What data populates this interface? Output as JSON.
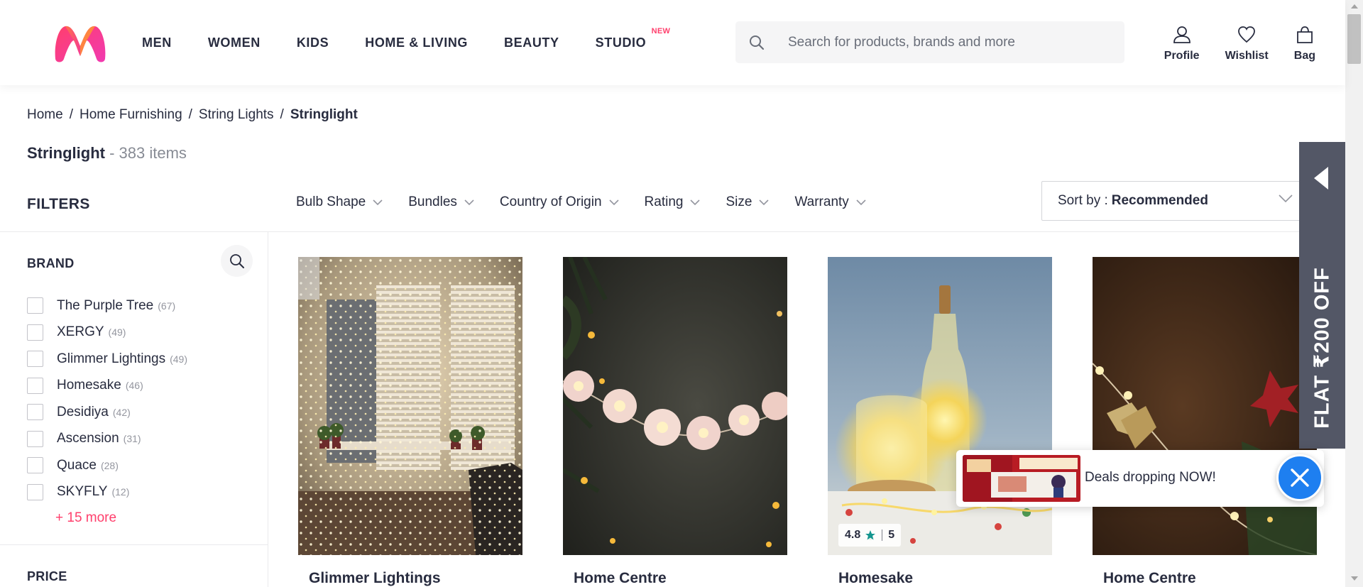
{
  "header": {
    "logo": "myntra-logo",
    "nav": [
      {
        "label": "MEN"
      },
      {
        "label": "WOMEN"
      },
      {
        "label": "KIDS"
      },
      {
        "label": "HOME & LIVING"
      },
      {
        "label": "BEAUTY"
      },
      {
        "label": "STUDIO",
        "badge": "NEW"
      }
    ],
    "search_placeholder": "Search for products, brands and more",
    "actions": {
      "profile": "Profile",
      "wishlist": "Wishlist",
      "bag": "Bag"
    }
  },
  "breadcrumb": [
    "Home",
    "Home Furnishing",
    "String Lights",
    "Stringlight"
  ],
  "breadcrumb_separator": "/",
  "title": {
    "name": "Stringlight",
    "count": "- 383 items"
  },
  "filters": {
    "heading": "FILTERS",
    "chips": [
      "Bulb Shape",
      "Bundles",
      "Country of Origin",
      "Rating",
      "Size",
      "Warranty"
    ],
    "sort_label": "Sort by :",
    "sort_value": "Recommended"
  },
  "sidebar": {
    "brand_heading": "BRAND",
    "brands": [
      {
        "name": "The Purple Tree",
        "count": "(67)"
      },
      {
        "name": "XERGY",
        "count": "(49)"
      },
      {
        "name": "Glimmer Lightings",
        "count": "(49)"
      },
      {
        "name": "Homesake",
        "count": "(46)"
      },
      {
        "name": "Desidiya",
        "count": "(42)"
      },
      {
        "name": "Ascension",
        "count": "(31)"
      },
      {
        "name": "Quace",
        "count": "(28)"
      },
      {
        "name": "SKYFLY",
        "count": "(12)"
      }
    ],
    "more_link": "+ 15 more",
    "price_heading": "PRICE"
  },
  "products": [
    {
      "brand": "Glimmer Lightings"
    },
    {
      "brand": "Home Centre"
    },
    {
      "brand": "Homesake",
      "rating": "4.8",
      "rating_count": "5"
    },
    {
      "brand": "Home Centre"
    }
  ],
  "offer_tab": {
    "text": "FLAT ₹200 OFF"
  },
  "deals_popup": {
    "text": "Deals dropping NOW!"
  },
  "colors": {
    "accent": "#ff3f6c",
    "text": "#282c3f",
    "muted": "#878b94",
    "rating_star": "#14958f",
    "close_blue": "#1e7ff0",
    "offer_tab": "#535766"
  }
}
